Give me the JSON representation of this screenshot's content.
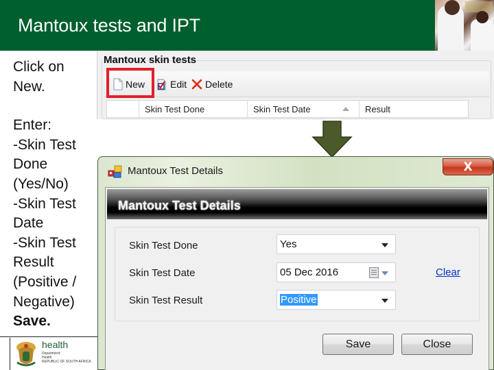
{
  "slide": {
    "title": "Mantoux tests and IPT",
    "instructions": {
      "step1": [
        "Click on",
        "New."
      ],
      "step2": [
        "Enter:",
        "-Skin Test",
        "Done",
        "(Yes/No)",
        "-Skin Test",
        "Date",
        "-Skin Test",
        "Result",
        "(Positive /",
        "Negative)"
      ],
      "final": "Save."
    },
    "footer_logo": {
      "name": "health",
      "line1": "Department:",
      "line2": "Health",
      "line3": "REPUBLIC OF SOUTH AFRICA"
    }
  },
  "skin_tests_panel": {
    "heading": "Mantoux skin tests",
    "toolbar": {
      "new_label": "New",
      "edit_label": "Edit",
      "delete_label": "Delete"
    },
    "grid_columns": [
      "Skin Test Done",
      "Skin Test Date",
      "Result"
    ],
    "sorted_column": "Skin Test Date"
  },
  "dialog": {
    "window_title": "Mantoux Test Details",
    "close_glyph": "X",
    "banner_title": "Mantoux Test Details",
    "fields": {
      "done_label": "Skin Test Done",
      "done_value": "Yes",
      "date_label": "Skin Test Date",
      "date_value": "05 Dec 2016",
      "result_label": "Skin Test Result",
      "result_value": "Positive"
    },
    "clear_link": "Clear",
    "save_label": "Save",
    "close_label": "Close"
  },
  "colors": {
    "header_green": "#005f2e",
    "highlight_red": "#e0202a",
    "arrow_olive": "#4b5a2a",
    "selection_blue": "#3399ff",
    "link_blue": "#0033cc"
  }
}
